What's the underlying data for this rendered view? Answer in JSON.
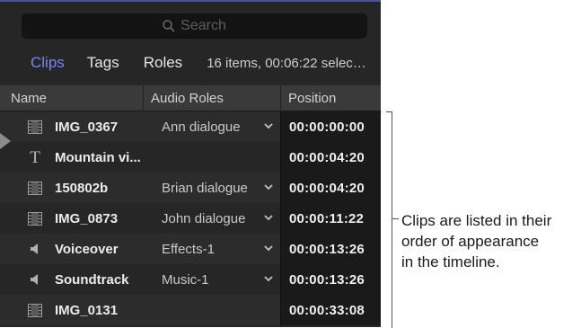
{
  "search": {
    "placeholder": "Search"
  },
  "tabs": [
    {
      "label": "Clips",
      "active": true
    },
    {
      "label": "Tags",
      "active": false
    },
    {
      "label": "Roles",
      "active": false
    }
  ],
  "summary": "16 items, 00:06:22 selec…",
  "columns": {
    "name": "Name",
    "roles": "Audio Roles",
    "position": "Position"
  },
  "rows": [
    {
      "icon": "film-icon",
      "name": "IMG_0367",
      "role": "Ann dialogue",
      "has_dropdown": true,
      "position": "00:00:00:00"
    },
    {
      "icon": "title-icon",
      "name": "Mountain vi...",
      "role": "",
      "has_dropdown": false,
      "position": "00:00:04:20"
    },
    {
      "icon": "film-icon",
      "name": "150802b",
      "role": "Brian dialogue",
      "has_dropdown": true,
      "position": "00:00:04:20"
    },
    {
      "icon": "film-icon",
      "name": "IMG_0873",
      "role": "John dialogue",
      "has_dropdown": true,
      "position": "00:00:11:22"
    },
    {
      "icon": "speaker-icon",
      "name": "Voiceover",
      "role": "Effects-1",
      "has_dropdown": true,
      "position": "00:00:13:26"
    },
    {
      "icon": "speaker-icon",
      "name": "Soundtrack",
      "role": "Music-1",
      "has_dropdown": true,
      "position": "00:00:13:26"
    },
    {
      "icon": "film-icon",
      "name": "IMG_0131",
      "role": "",
      "has_dropdown": false,
      "position": "00:00:33:08"
    }
  ],
  "callout": {
    "lines": [
      "Clips are listed in their",
      "order of appearance",
      "in the timeline."
    ]
  },
  "colors": {
    "accent": "#7f84f0",
    "panel": "#262626",
    "position_bg": "#1a1a1a"
  }
}
